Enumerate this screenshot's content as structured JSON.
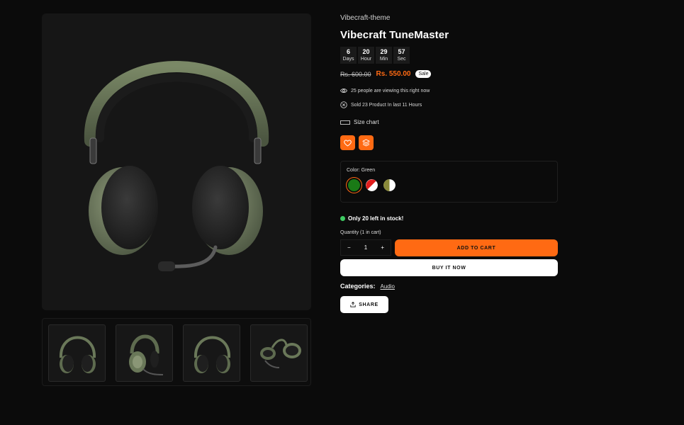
{
  "product": {
    "vendor": "Vibecraft-theme",
    "title": "Vibecraft TuneMaster",
    "image_alt": "green-headphones-product-image"
  },
  "countdown": [
    {
      "value": "6",
      "unit": "Days"
    },
    {
      "value": "20",
      "unit": "Hour"
    },
    {
      "value": "29",
      "unit": "Min"
    },
    {
      "value": "57",
      "unit": "Sec"
    }
  ],
  "price": {
    "compare_at": "Rs. 600.00",
    "current": "Rs. 550.00",
    "badge": "Sale"
  },
  "meta": {
    "viewing": "25 people are viewing this right now",
    "sold": "Sold 23 Product In last 11 Hours",
    "size_chart": "Size chart"
  },
  "actions": {
    "wishlist_icon": "heart-icon",
    "compare_icon": "layers-icon"
  },
  "variant": {
    "label": "Color:",
    "selected": "Green",
    "swatches": [
      "Green",
      "Red-White",
      "Olive-White"
    ]
  },
  "stock": {
    "text": "Only 20 left in stock!"
  },
  "quantity": {
    "label": "Quantity",
    "in_cart": "(1 in cart)",
    "minus": "−",
    "value": "1",
    "plus": "+"
  },
  "buttons": {
    "add_to_cart": "ADD TO CART",
    "buy_now": "BUY IT NOW",
    "share": "SHARE"
  },
  "categories": {
    "label": "Categories:",
    "value": "Audio"
  },
  "colors": {
    "accent": "#ff6a13",
    "background": "#0b0b0b",
    "headphone_green": "#6a7859",
    "stock_dot": "#3ecb62"
  }
}
